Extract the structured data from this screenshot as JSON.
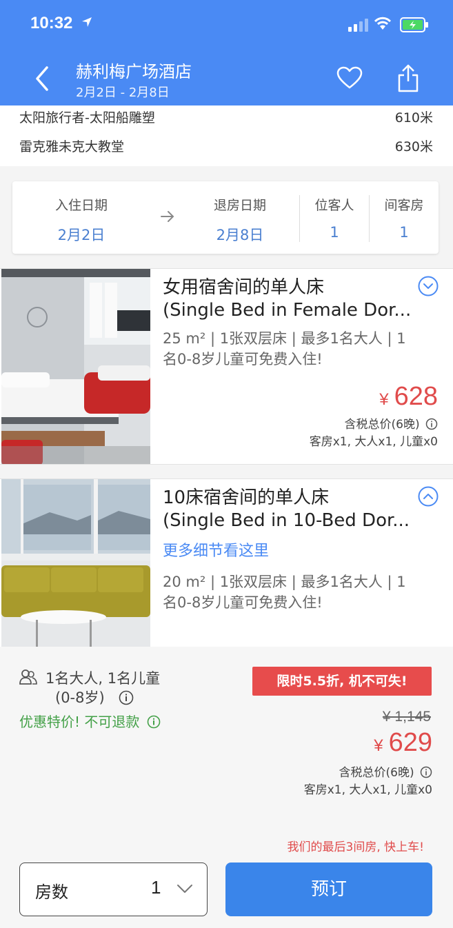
{
  "status_bar": {
    "time": "10:32"
  },
  "header": {
    "title": "赫利梅广场酒店",
    "dates": "2月2日 - 2月8日"
  },
  "nearby": [
    {
      "name": "太阳旅行者-太阳船雕塑",
      "distance": "610米"
    },
    {
      "name": "雷克雅未克大教堂",
      "distance": "630米"
    }
  ],
  "date_bar": {
    "checkin_label": "入住日期",
    "checkin_value": "2月2日",
    "checkout_label": "退房日期",
    "checkout_value": "2月8日",
    "guests_label": "位客人",
    "guests_value": "1",
    "rooms_label": "间客房",
    "rooms_value": "1"
  },
  "rooms": [
    {
      "title_line1": "女用宿舍间的单人床",
      "title_line2": "(Single Bed in Female Dor...",
      "detail_line1": "25 m² | 1张双层床 | 最多1名大人 | 1",
      "detail_line2": "名0-8岁儿童可免费入住!",
      "currency": "¥",
      "price": "628",
      "price_note": "含税总价(6晚)",
      "occupancy": "客房x1, 大人x1, 儿童x0"
    },
    {
      "title_line1": "10床宿舍间的单人床",
      "title_line2": "(Single Bed in 10-Bed Dor...",
      "more_link": "更多细节看这里",
      "detail_line1": "20 m² | 1张双层床 | 最多1名大人 | 1",
      "detail_line2": "名0-8岁儿童可免费入住!"
    }
  ],
  "booking": {
    "guests_line1": "1名大人, 1名儿童",
    "guests_line2": "(0-8岁)",
    "special": "优惠特价! 不可退款",
    "promo": "限时5.5折, 机不可失!",
    "original_price": "¥ 1,145",
    "currency": "¥",
    "price": "629",
    "price_note": "含税总价(6晚)",
    "occupancy": "客房x1, 大人x1, 儿童x0",
    "last_rooms": "我们的最后3间房, 快上车!",
    "qty_label": "房数",
    "qty_value": "1",
    "book_label": "预订"
  },
  "colors": {
    "header": "#4a8af4",
    "price": "#e04b4b",
    "link": "#4a8af4",
    "special": "#43a047",
    "button": "#3a85ea"
  }
}
